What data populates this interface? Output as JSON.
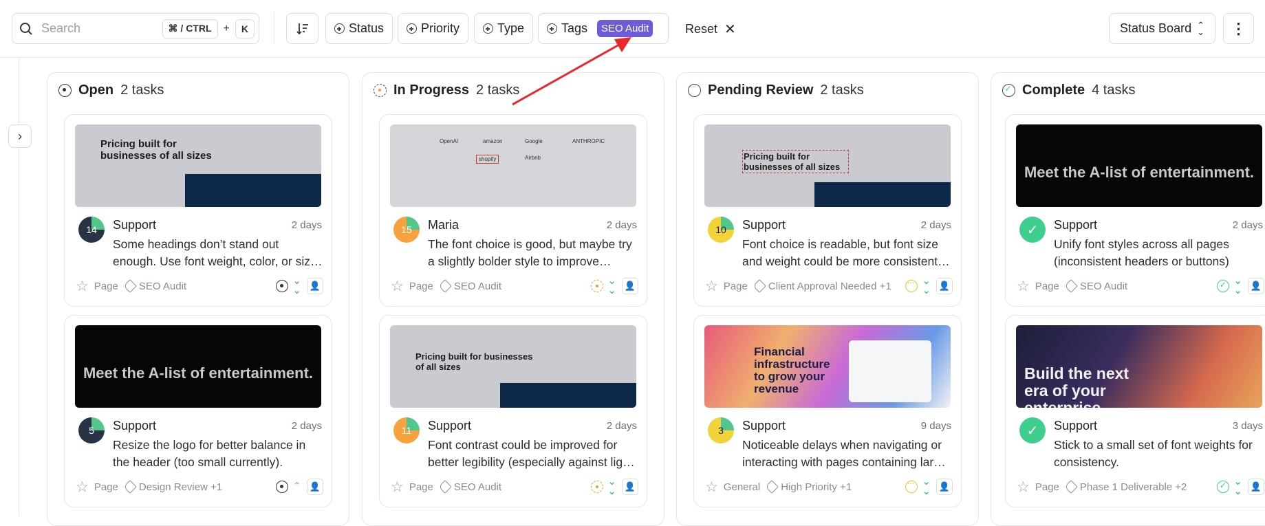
{
  "toolbar": {
    "search_placeholder": "Search",
    "shortcut_mod": "⌘ / CTRL",
    "shortcut_plus": "+",
    "shortcut_key": "K",
    "filters": [
      "Status",
      "Priority",
      "Type",
      "Tags"
    ],
    "active_tag": "SEO Audit",
    "reset_label": "Reset",
    "view_label": "Status Board",
    "accent_color": "#6e5bd9"
  },
  "columns": [
    {
      "title": "Open",
      "count": "2 tasks",
      "cards": [
        {
          "num": "14",
          "author": "Support",
          "age": "2 days",
          "text": "Some headings don’t stand out enough. Use font weight, color, or size to create better hierarchy.",
          "type": "Page",
          "tags": "SEO Audit",
          "thumb_title": "Pricing built for businesses of all sizes"
        },
        {
          "num": "5",
          "author": "Support",
          "age": "2 days",
          "text": "Resize the logo for better balance in the header (too small currently).",
          "type": "Page",
          "tags": "Design Review +1",
          "thumb_title": "Meet the A-list of entertainment."
        }
      ]
    },
    {
      "title": "In Progress",
      "count": "2 tasks",
      "cards": [
        {
          "num": "15",
          "author": "Maria",
          "age": "2 days",
          "text": "The font choice is good, but maybe try a slightly bolder style to improve readability.",
          "type": "Page",
          "tags": "SEO Audit",
          "thumb_logos": [
            "OpenAI",
            "amazon",
            "Google",
            "ANTHROPIC",
            "shopify",
            "Airbnb"
          ]
        },
        {
          "num": "11",
          "author": "Support",
          "age": "2 days",
          "text": "Font contrast could be improved for better legibility (especially against light backgrounds).",
          "type": "Page",
          "tags": "SEO Audit",
          "thumb_title": "Pricing built for businesses of all sizes"
        }
      ]
    },
    {
      "title": "Pending Review",
      "count": "2 tasks",
      "cards": [
        {
          "num": "10",
          "author": "Support",
          "age": "2 days",
          "text": "Font choice is readable, but font size and weight could be more consistent, especially in headings.",
          "type": "Page",
          "tags": "Client Approval Needed +1",
          "thumb_title": "Pricing built for businesses of all sizes"
        },
        {
          "num": "3",
          "author": "Support",
          "age": "9 days",
          "text": "Noticeable delays when navigating or interacting with pages containing large images.",
          "type": "General",
          "tags": "High Priority +1",
          "thumb_title": "Financial infrastructure to grow your revenue"
        }
      ]
    },
    {
      "title": "Complete",
      "count": "4 tasks",
      "cards": [
        {
          "num": "✓",
          "author": "Support",
          "age": "2 days",
          "text": "Unify font styles across all pages (inconsistent headers or buttons)",
          "type": "Page",
          "tags": "SEO Audit",
          "thumb_title": "Meet the A-list of entertainment."
        },
        {
          "num": "✓",
          "author": "Support",
          "age": "3 days",
          "text": "Stick to a small set of font weights for consistency.",
          "type": "Page",
          "tags": "Phase 1 Deliverable +2",
          "thumb_title": "Build the next era of your enterprise"
        }
      ]
    }
  ]
}
